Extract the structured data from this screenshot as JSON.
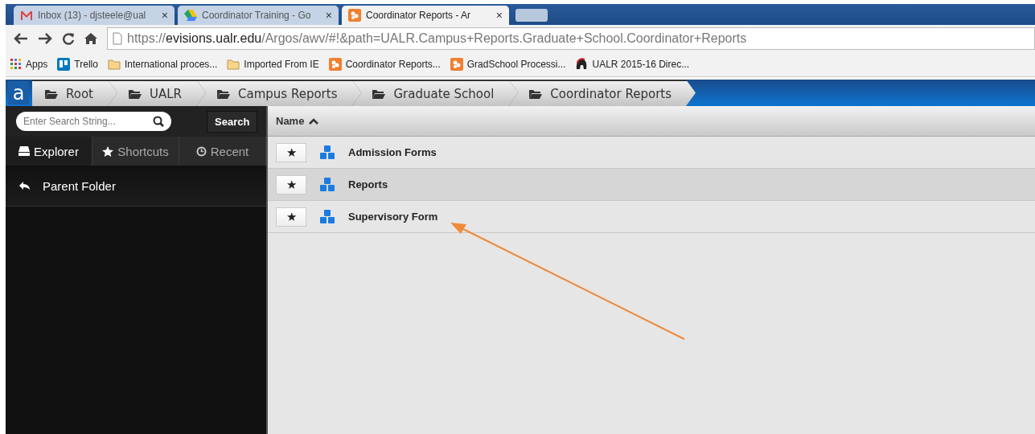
{
  "browser": {
    "tabs": [
      {
        "title": "Inbox (13) - djsteele@ual",
        "close": "×",
        "selected": false
      },
      {
        "title": "Coordinator Training - Go",
        "close": "×",
        "selected": false
      },
      {
        "title": "Coordinator Reports - Ar",
        "close": "×",
        "selected": true
      }
    ],
    "address": {
      "scheme": "https://",
      "host": "evisions.ualr.edu",
      "path": "/Argos/awv/#!&path=UALR.Campus+Reports.Graduate+School.Coordinator+Reports"
    },
    "bookmarks": [
      "Apps",
      "Trello",
      "International proces...",
      "Imported From IE",
      "Coordinator Reports...",
      "GradSchool Processi...",
      "UALR 2015-16 Direc..."
    ]
  },
  "app": {
    "logo": "a",
    "breadcrumbs": [
      "Root",
      "UALR",
      "Campus Reports",
      "Graduate School",
      "Coordinator Reports"
    ],
    "search": {
      "placeholder": "Enter Search String...",
      "button": "Search"
    },
    "sidebar_tabs": [
      {
        "label": "Explorer",
        "selected": true
      },
      {
        "label": "Shortcuts",
        "selected": false
      },
      {
        "label": "Recent",
        "selected": false
      }
    ],
    "parent_folder": "Parent Folder",
    "table": {
      "column": "Name",
      "rows": [
        {
          "name": "Admission Forms",
          "star": "★",
          "selected": false
        },
        {
          "name": "Reports",
          "star": "★",
          "selected": true
        },
        {
          "name": "Supervisory Form",
          "star": "★",
          "selected": false
        }
      ]
    }
  }
}
